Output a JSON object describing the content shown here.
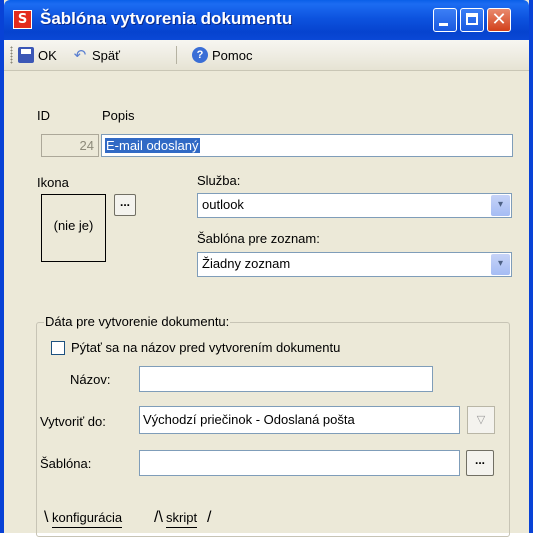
{
  "window": {
    "title": "Šablóna vytvorenia dokumentu",
    "app_icon_glyph": "S",
    "app_icon_color": "#e32b1d",
    "titlebar_color": "#0a4fdc",
    "buttons": {
      "minimize": "minimize-icon",
      "maximize": "maximize-icon",
      "close": "close-icon",
      "close_glyph": "✕"
    }
  },
  "toolbar": {
    "ok_label": "OK",
    "back_label": "Späť",
    "help_label": "Pomoc",
    "help_glyph": "?",
    "undo_glyph": "↶"
  },
  "form": {
    "id_label": "ID",
    "id_value": "24",
    "popis_label": "Popis",
    "popis_value": "E-mail odoslaný",
    "ikona_label": "Ikona",
    "ikona_value": "(nie je)",
    "ikona_button": "...",
    "sluzba_label": "Služba:",
    "sluzba_value": "outlook",
    "sablona_zoznam_label": "Šablóna pre zoznam:",
    "sablona_zoznam_value": "Žiadny zoznam",
    "dropdown_glyph": "▾"
  },
  "group": {
    "title": "Dáta pre vytvorenie dokumentu:",
    "checkbox_label": "Pýtať sa na názov pred vytvorením dokumentu",
    "checkbox_checked": false,
    "nazov_label": "Názov:",
    "nazov_value": "",
    "vytvorit_label": "Vytvoriť do:",
    "vytvorit_value": "Východzí priečinok - Odoslaná pošta",
    "vytvorit_button_glyph": "▽",
    "sablona_label": "Šablóna:",
    "sablona_value": "",
    "sablona_button": "..."
  },
  "tabs": [
    {
      "label": "konfigurácia",
      "active": true
    },
    {
      "label": "skript",
      "active": false
    }
  ]
}
